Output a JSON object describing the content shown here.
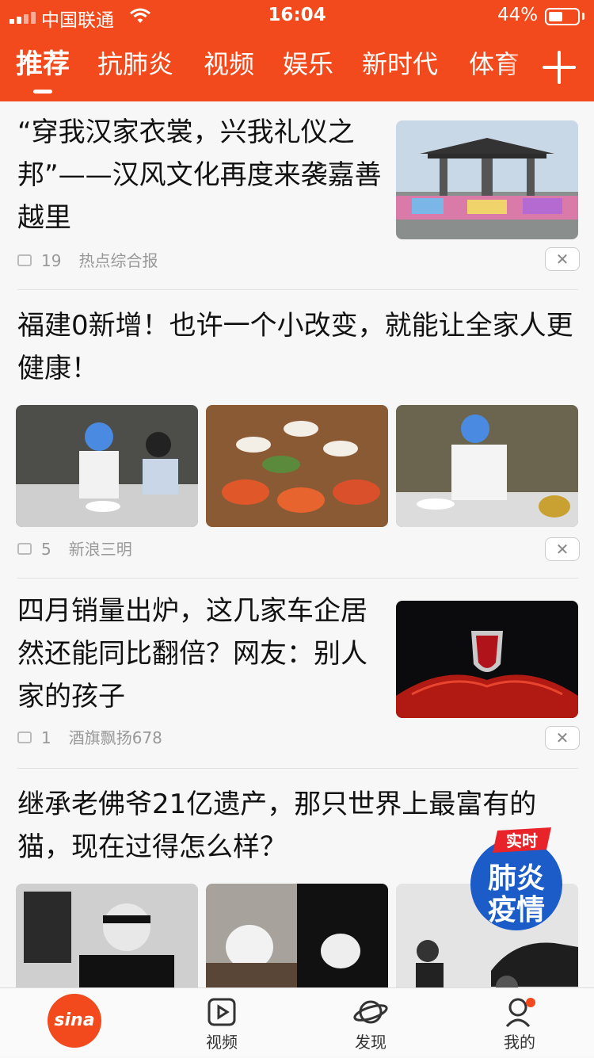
{
  "status": {
    "carrier": "中国联通",
    "time": "16:04",
    "battery": "44%"
  },
  "tabs": [
    "推荐",
    "抗肺炎",
    "视频",
    "娱乐",
    "新时代",
    "体育"
  ],
  "articles": [
    {
      "title": "“穿我汉家衣裳，兴我礼仪之邦”——汉风文化再度来袭嘉善越里",
      "comments": "19",
      "source": "热点综合报"
    },
    {
      "title": "福建0新增！也许一个小改变，就能让全家人更健康！",
      "comments": "5",
      "source": "新浪三明"
    },
    {
      "title": "四月销量出炉，这几家车企居然还能同比翻倍？网友：别人家的孩子",
      "comments": "1",
      "source": "酒旗飘扬678"
    },
    {
      "title": "继承老佛爷21亿遗产，那只世界上最富有的猫，现在过得怎么样？"
    }
  ],
  "close_glyph": "✕",
  "badge": {
    "top": "实时",
    "line1": "肺炎",
    "line2": "疫情"
  },
  "bottom_nav": {
    "home": "sina",
    "video": "视频",
    "discover": "发现",
    "me": "我的"
  },
  "colors": {
    "brand": "#f24a1c",
    "text": "#111111",
    "meta": "#999999"
  }
}
